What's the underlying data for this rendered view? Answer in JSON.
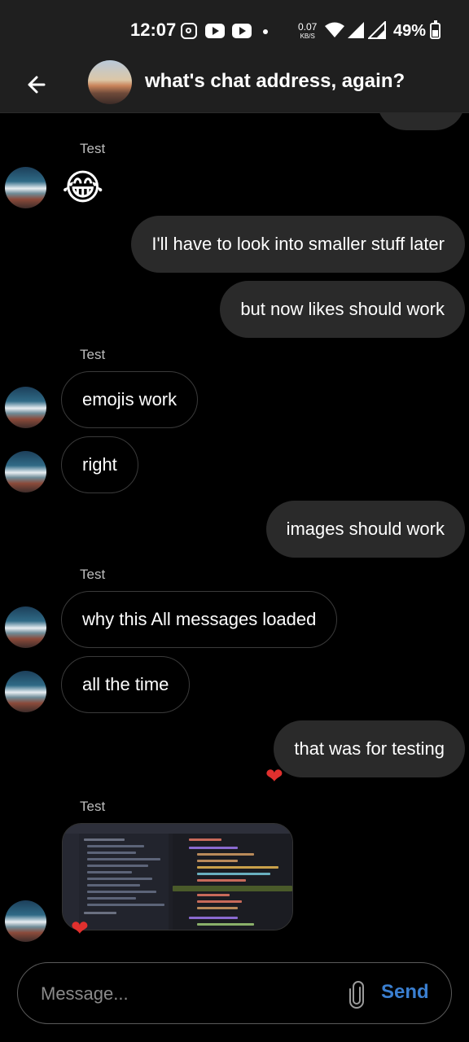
{
  "status_bar": {
    "time": "12:07",
    "speed_value": "0.07",
    "speed_unit": "KB/S",
    "battery": "49%",
    "icons": [
      "instagram-icon",
      "youtube-icon",
      "youtube-icon",
      "dot-icon",
      "wifi-icon",
      "signal-icon",
      "signal-icon",
      "battery-icon"
    ]
  },
  "header": {
    "title": "what's chat address, again?",
    "back_icon": "arrow-left-icon"
  },
  "messages": [
    {
      "sender": "Test",
      "type": "emoji",
      "text": "😂"
    },
    {
      "type": "outgoing",
      "text": "I'll have to look into smaller stuff later"
    },
    {
      "type": "outgoing",
      "text": "but now likes should work"
    },
    {
      "sender": "Test",
      "type": "incoming",
      "text": "emojis work"
    },
    {
      "type": "incoming",
      "text": "right"
    },
    {
      "type": "outgoing",
      "text": "images should work"
    },
    {
      "sender": "Test",
      "type": "incoming",
      "text": "why this All messages loaded"
    },
    {
      "type": "incoming",
      "text": "all the time"
    },
    {
      "type": "outgoing",
      "text": "that was for testing",
      "reaction": "heart"
    },
    {
      "sender": "Test",
      "type": "image",
      "reaction": "heart"
    }
  ],
  "senders": [
    "Test",
    "Test",
    "Test",
    "Test"
  ],
  "reaction_glyph": "❤",
  "composer": {
    "placeholder": "Message...",
    "attach_icon": "paperclip-icon",
    "send_label": "Send"
  },
  "colors": {
    "background": "#000000",
    "outgoing_bubble": "#2a2a2a",
    "incoming_border": "#3a3a3a",
    "send_accent": "#3a7fd1",
    "heart": "#e0302e"
  }
}
